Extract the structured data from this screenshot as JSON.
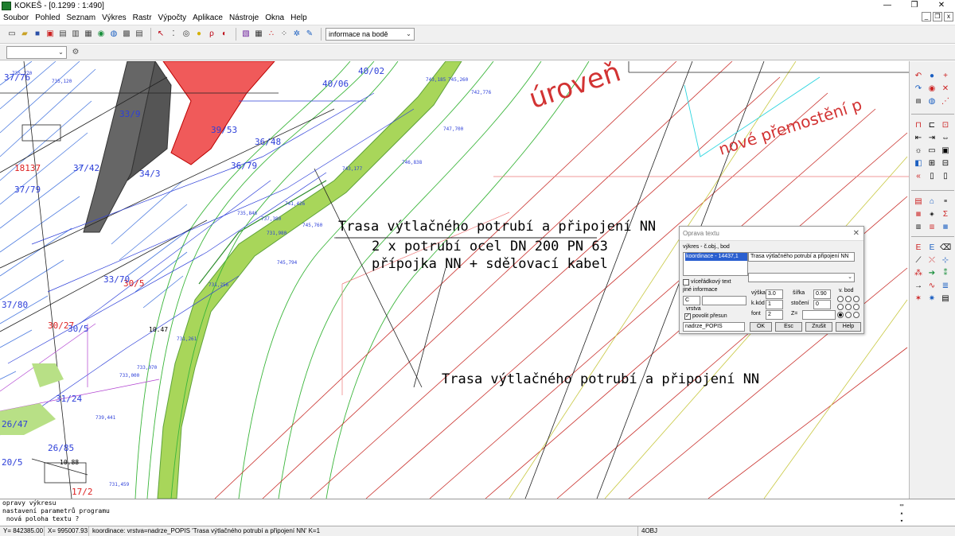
{
  "window": {
    "title": "KOKEŠ - [0.1299 : 1:490]",
    "minimize": "—",
    "maximize": "❐",
    "close": "✕"
  },
  "menu": [
    "Soubor",
    "Pohled",
    "Seznam",
    "Výkres",
    "Rastr",
    "Výpočty",
    "Aplikace",
    "Nástroje",
    "Okna",
    "Help"
  ],
  "toolbar": {
    "info_combo": "informace na bodě",
    "layer_combo": ""
  },
  "icons": {
    "new": "🗋",
    "open": "📂",
    "save": "💾",
    "print": "🖨",
    "pointer": "↖",
    "zoom": "⊕",
    "globe": "🌐",
    "key": "⚿",
    "tools": "✎"
  },
  "drawing": {
    "texts": [
      "Trasa výtlačného potrubí a připojení NN",
      "2 x potrubí ocel DN 200 PN 63",
      "přípojka NN + sdělovací kabel",
      "Trasa výtlačného potrubí a připojení NN"
    ],
    "red_texts": [
      "úroveň",
      "nové přemostění p"
    ],
    "red_labels": [
      "18137",
      "30/27",
      "30/5",
      "17/2"
    ],
    "blue_labels": [
      "37/76",
      "37/42",
      "33/9",
      "37/79",
      "36/79",
      "34/3",
      "33/70",
      "37/80",
      "31/24",
      "30/5",
      "26/47",
      "26/85",
      "20/5",
      "39/53",
      "40/02",
      "36/48",
      "40/06"
    ],
    "small_numbers": [
      "735,270",
      "735,120",
      "743,185",
      "742,776",
      "745,260",
      "747,700",
      "746,838",
      "743,177",
      "745,760",
      "741,426",
      "745,794",
      "731,256",
      "735,846",
      "733,000",
      "731,261",
      "733,070",
      "739,441",
      "731,459",
      "737,380",
      "731,980"
    ],
    "dims": [
      "10.47",
      "10.88"
    ]
  },
  "dialog": {
    "title": "Oprava textu",
    "section_label": "výkres - č.obj., bod",
    "list_item": "koordinace - 14437,1",
    "text_value": "Trasa výtlačného potrubí a připojení NN",
    "multiline_label": "víceřádkový text",
    "other_info_label": "jiné informace",
    "other_combo": "C",
    "layer_label": "vrstva",
    "allow_move_label": "povolit přesun",
    "layer_value": "nadrze_POPIS",
    "height_label": "výška",
    "height_value": "3.0",
    "width_label": "šířka",
    "width_value": "0.90",
    "kkod_label": "k.kód",
    "kkod_value": "1",
    "rotation_label": "stočení",
    "rotation_value": "0",
    "font_label": "font",
    "font_value": "2",
    "z_label": "Z=",
    "z_value": "",
    "vbod_label": "v. bod",
    "ok": "OK",
    "esc": "Esc",
    "cancel": "Zrušit",
    "help": "Help"
  },
  "console": {
    "lines": [
      "opravy výkresu",
      "nastavení parametrů programu",
      " nová poloha textu ?"
    ]
  },
  "status": {
    "y": "Y=   842385.00",
    "x": "X=   995007.93",
    "message": "koordinace: vrstva=nadrze_POPIS  'Trasa výtlačného potrubí a připojení NN' K=1",
    "count": "4OBJ"
  }
}
